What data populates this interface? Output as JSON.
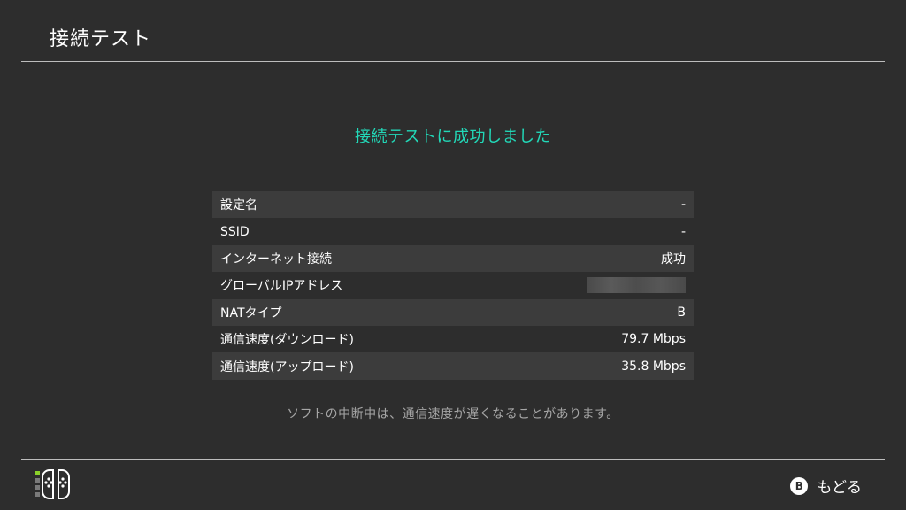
{
  "header": {
    "title": "接続テスト"
  },
  "result": {
    "message": "接続テストに成功しました"
  },
  "table": {
    "rows": [
      {
        "label": "設定名",
        "value": "-"
      },
      {
        "label": "SSID",
        "value": "-"
      },
      {
        "label": "インターネット接続",
        "value": "成功"
      },
      {
        "label": "グローバルIPアドレス",
        "value": ""
      },
      {
        "label": "NATタイプ",
        "value": "B"
      },
      {
        "label": "通信速度(ダウンロード)",
        "value": "79.7 Mbps"
      },
      {
        "label": "通信速度(アップロード)",
        "value": "35.8 Mbps"
      }
    ]
  },
  "note": "ソフトの中断中は、通信速度が遅くなることがあります。",
  "footer": {
    "button_glyph": "B",
    "back_label": "もどる"
  },
  "colors": {
    "accent": "#22d8b8",
    "background": "#2d2d2d",
    "row_stripe": "#3c3c3c",
    "controller_indicator": "#8bd12a"
  }
}
